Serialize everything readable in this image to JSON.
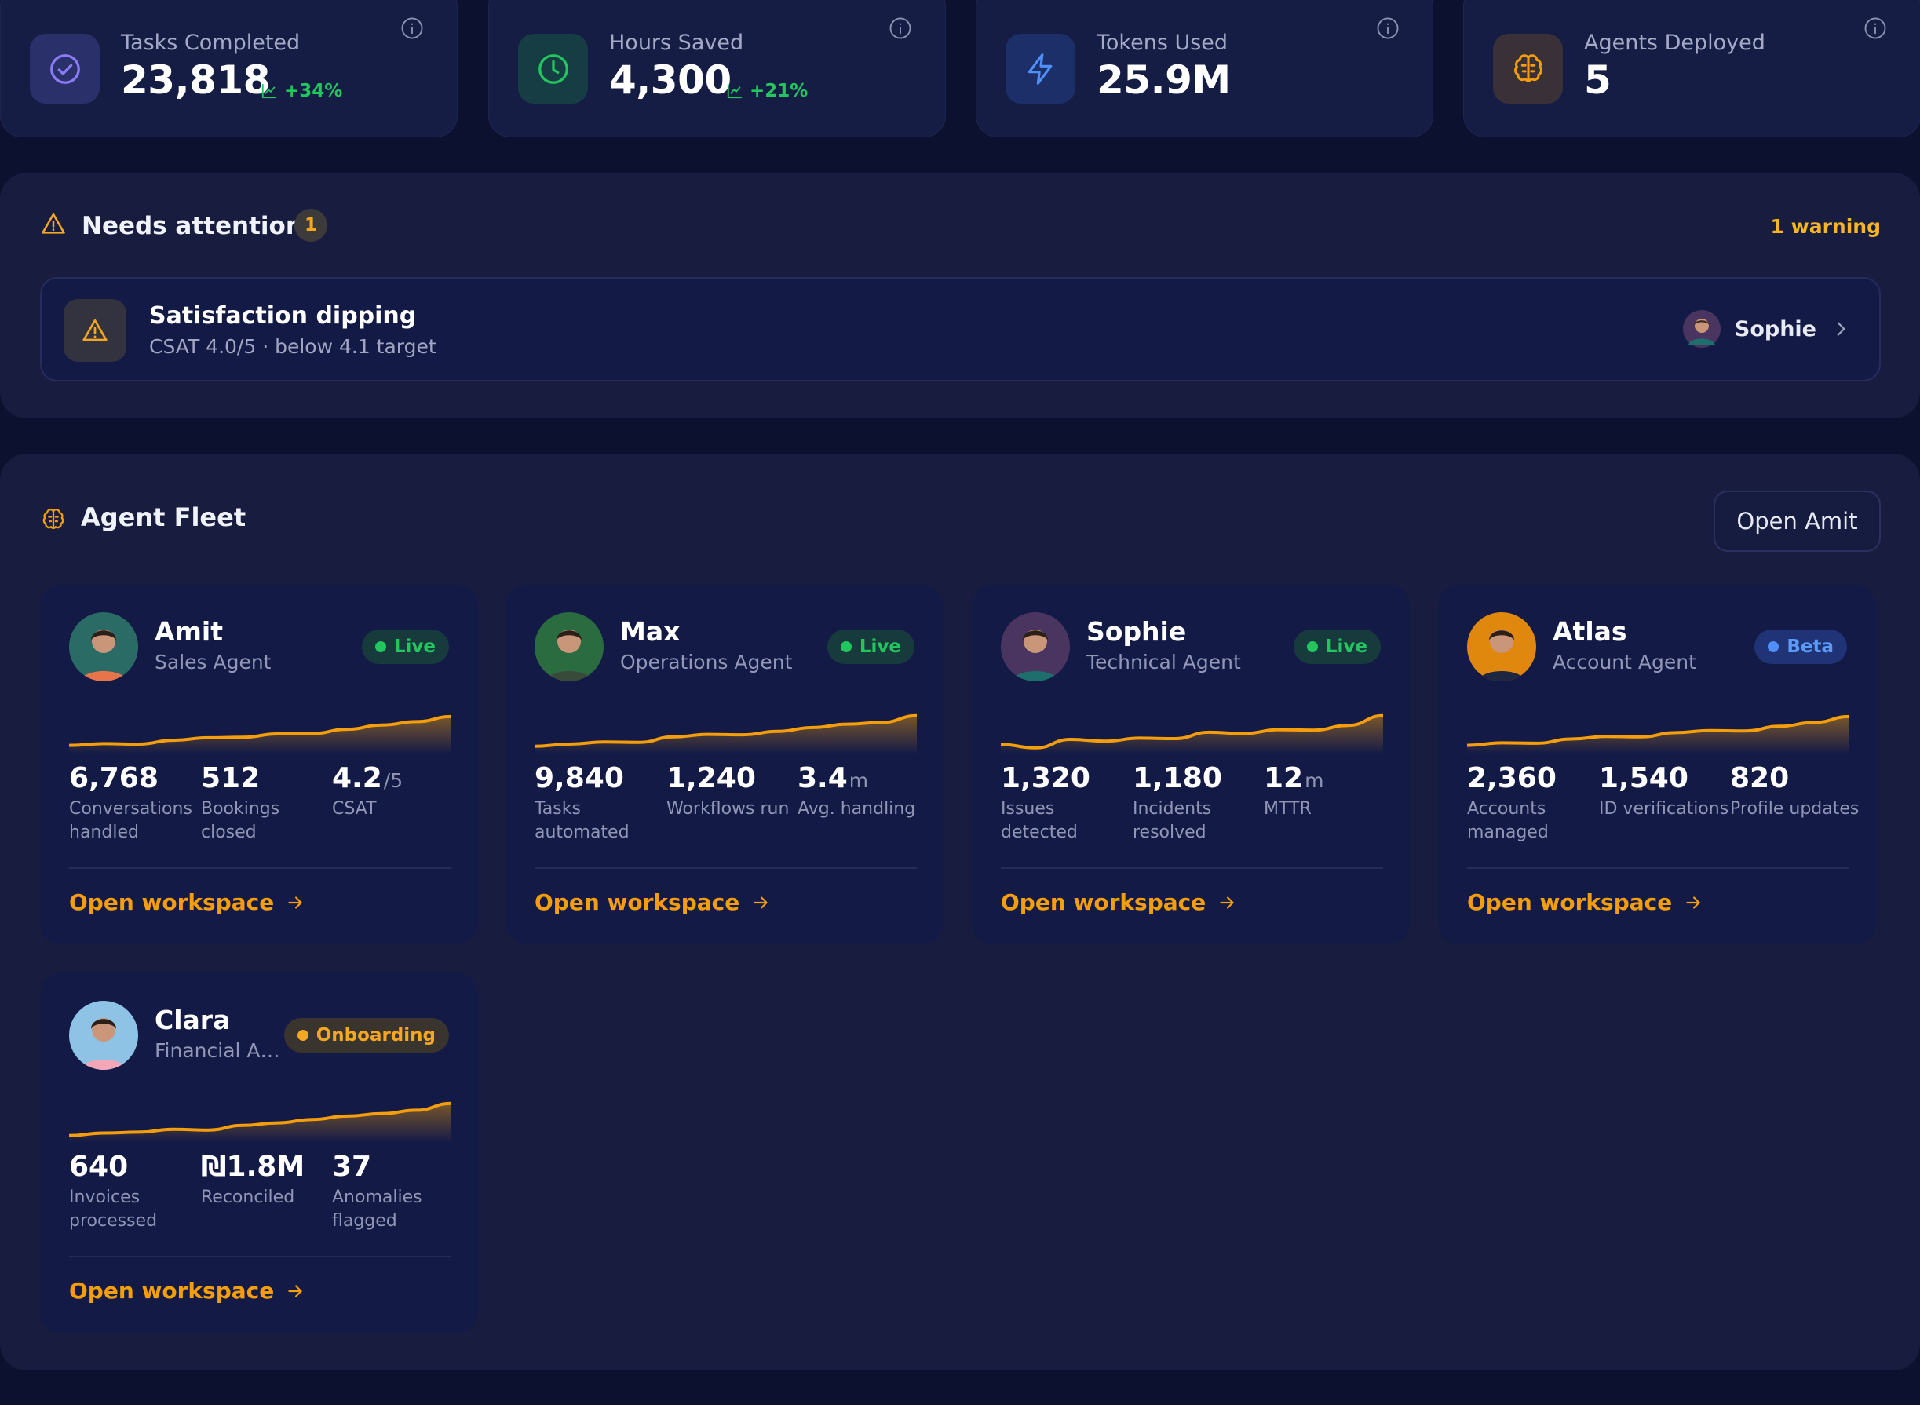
{
  "stats": [
    {
      "label": "Tasks Completed",
      "value": "23,818",
      "delta": "+34%",
      "icon": "check-circle-icon",
      "icon_bg": "#29306a",
      "icon_color": "#8b7cf6"
    },
    {
      "label": "Hours Saved",
      "value": "4,300",
      "delta": "+21%",
      "icon": "clock-icon",
      "icon_bg": "#163d43",
      "icon_color": "#22c55e"
    },
    {
      "label": "Tokens Used",
      "value": "25.9M",
      "delta": "",
      "icon": "lightning-icon",
      "icon_bg": "#1d2f69",
      "icon_color": "#4f8ff7"
    },
    {
      "label": "Agents Deployed",
      "value": "5",
      "delta": "",
      "icon": "brain-icon",
      "icon_bg": "#3a3037",
      "icon_color": "#f59e0b"
    }
  ],
  "attention": {
    "title": "Needs attention",
    "count": "1",
    "summary": "1 warning",
    "alert": {
      "title": "Satisfaction dipping",
      "subtitle": "CSAT 4.0/5 · below 4.1 target",
      "owner": "Sophie"
    }
  },
  "fleet": {
    "title": "Agent Fleet",
    "open_button": "Open Amit",
    "open_workspace_label": "Open workspace",
    "agents": [
      {
        "name": "Amit",
        "role": "Sales Agent",
        "status": "Live",
        "status_kind": "live",
        "avatar_colors": [
          "#2a6b66",
          "#e8744a"
        ],
        "spark": [
          0.1,
          0.14,
          0.13,
          0.22,
          0.28,
          0.29,
          0.37,
          0.38,
          0.48,
          0.58,
          0.66,
          0.78
        ],
        "metrics": [
          {
            "value": "6,768",
            "unit": "",
            "label": "Conversations handled"
          },
          {
            "value": "512",
            "unit": "",
            "label": "Bookings closed"
          },
          {
            "value": "4.2",
            "unit": "/5",
            "label": "CSAT"
          }
        ]
      },
      {
        "name": "Max",
        "role": "Operations Agent",
        "status": "Live",
        "status_kind": "live",
        "avatar_colors": [
          "#2b6b40",
          "#384a3a"
        ],
        "spark": [
          0.08,
          0.13,
          0.18,
          0.17,
          0.3,
          0.36,
          0.35,
          0.43,
          0.52,
          0.6,
          0.64,
          0.8
        ],
        "metrics": [
          {
            "value": "9,840",
            "unit": "",
            "label": "Tasks automated"
          },
          {
            "value": "1,240",
            "unit": "",
            "label": "Workflows run"
          },
          {
            "value": "3.4",
            "unit": "m",
            "label": "Avg. handling"
          }
        ]
      },
      {
        "name": "Sophie",
        "role": "Technical Agent",
        "status": "Live",
        "status_kind": "live",
        "avatar_colors": [
          "#4a3560",
          "#1f6e6e"
        ],
        "spark": [
          0.12,
          0.04,
          0.24,
          0.2,
          0.27,
          0.26,
          0.41,
          0.38,
          0.47,
          0.46,
          0.57,
          0.8
        ],
        "metrics": [
          {
            "value": "1,320",
            "unit": "",
            "label": "Issues detected"
          },
          {
            "value": "1,180",
            "unit": "",
            "label": "Incidents resolved"
          },
          {
            "value": "12",
            "unit": "m",
            "label": "MTTR"
          }
        ]
      },
      {
        "name": "Atlas",
        "role": "Account Agent",
        "status": "Beta",
        "status_kind": "beta",
        "avatar_colors": [
          "#e0870e",
          "#1f2740"
        ],
        "spark": [
          0.1,
          0.16,
          0.15,
          0.25,
          0.31,
          0.3,
          0.4,
          0.45,
          0.44,
          0.55,
          0.64,
          0.78
        ],
        "metrics": [
          {
            "value": "2,360",
            "unit": "",
            "label": "Accounts managed"
          },
          {
            "value": "1,540",
            "unit": "",
            "label": "ID verifications"
          },
          {
            "value": "820",
            "unit": "",
            "label": "Profile updates"
          }
        ]
      },
      {
        "name": "Clara",
        "role": "Financial Ag...",
        "status": "Onboarding",
        "status_kind": "onboarding",
        "avatar_colors": [
          "#8fc3e6",
          "#f2a6b8"
        ],
        "spark": [
          0.06,
          0.12,
          0.14,
          0.21,
          0.19,
          0.3,
          0.36,
          0.44,
          0.52,
          0.58,
          0.66,
          0.82
        ],
        "metrics": [
          {
            "value": "640",
            "unit": "",
            "label": "Invoices processed"
          },
          {
            "value": "₪1.8M",
            "unit": "",
            "label": "Reconciled"
          },
          {
            "value": "37",
            "unit": "",
            "label": "Anomalies flagged"
          }
        ]
      }
    ]
  }
}
